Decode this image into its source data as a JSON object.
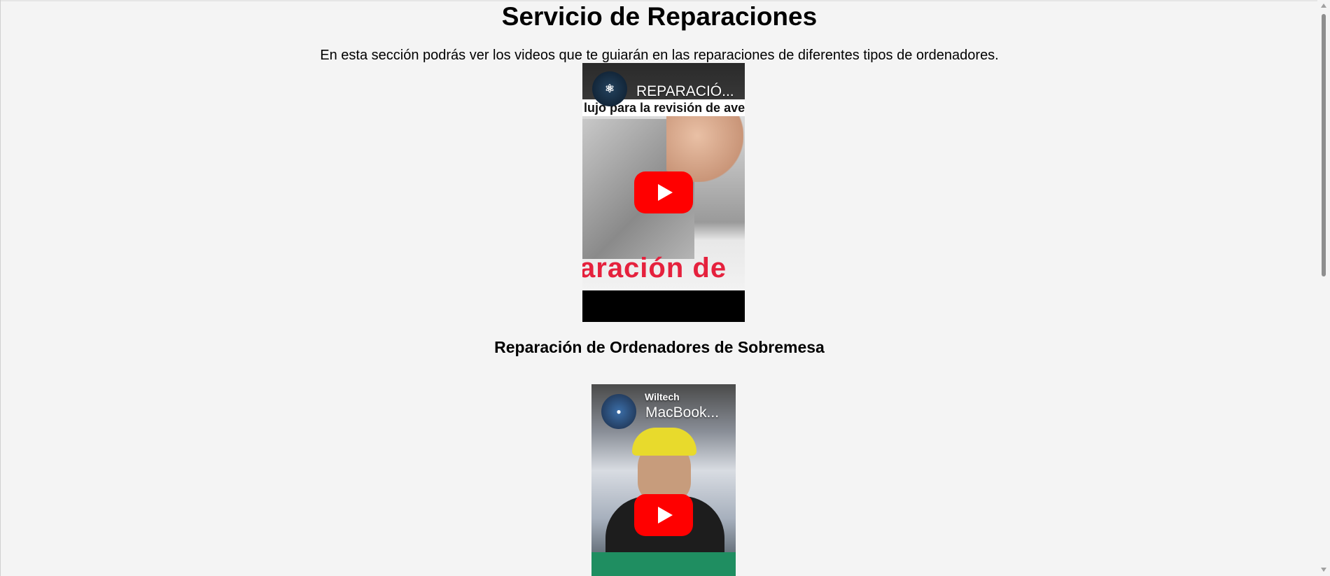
{
  "page": {
    "title": "Servicio de Reparaciones",
    "intro": "En esta sección podrás ver los videos que te guiarán en las reparaciones de diferentes tipos de ordenadores."
  },
  "videos": [
    {
      "title": "REPARACIÓ...",
      "thumbnail_caption": "lujo para la revisión de aver",
      "thumbnail_big_text": "aración de",
      "play_icon": "youtube-play-icon",
      "heading": "Reparación de Ordenadores de Sobremesa"
    },
    {
      "title": "MacBook...",
      "channel_mark": "Wiltech",
      "play_icon": "youtube-play-icon"
    }
  ],
  "colors": {
    "background": "#f4f4f4",
    "play_button": "#ff0000",
    "thumbnail_red_text": "#e5213d"
  }
}
